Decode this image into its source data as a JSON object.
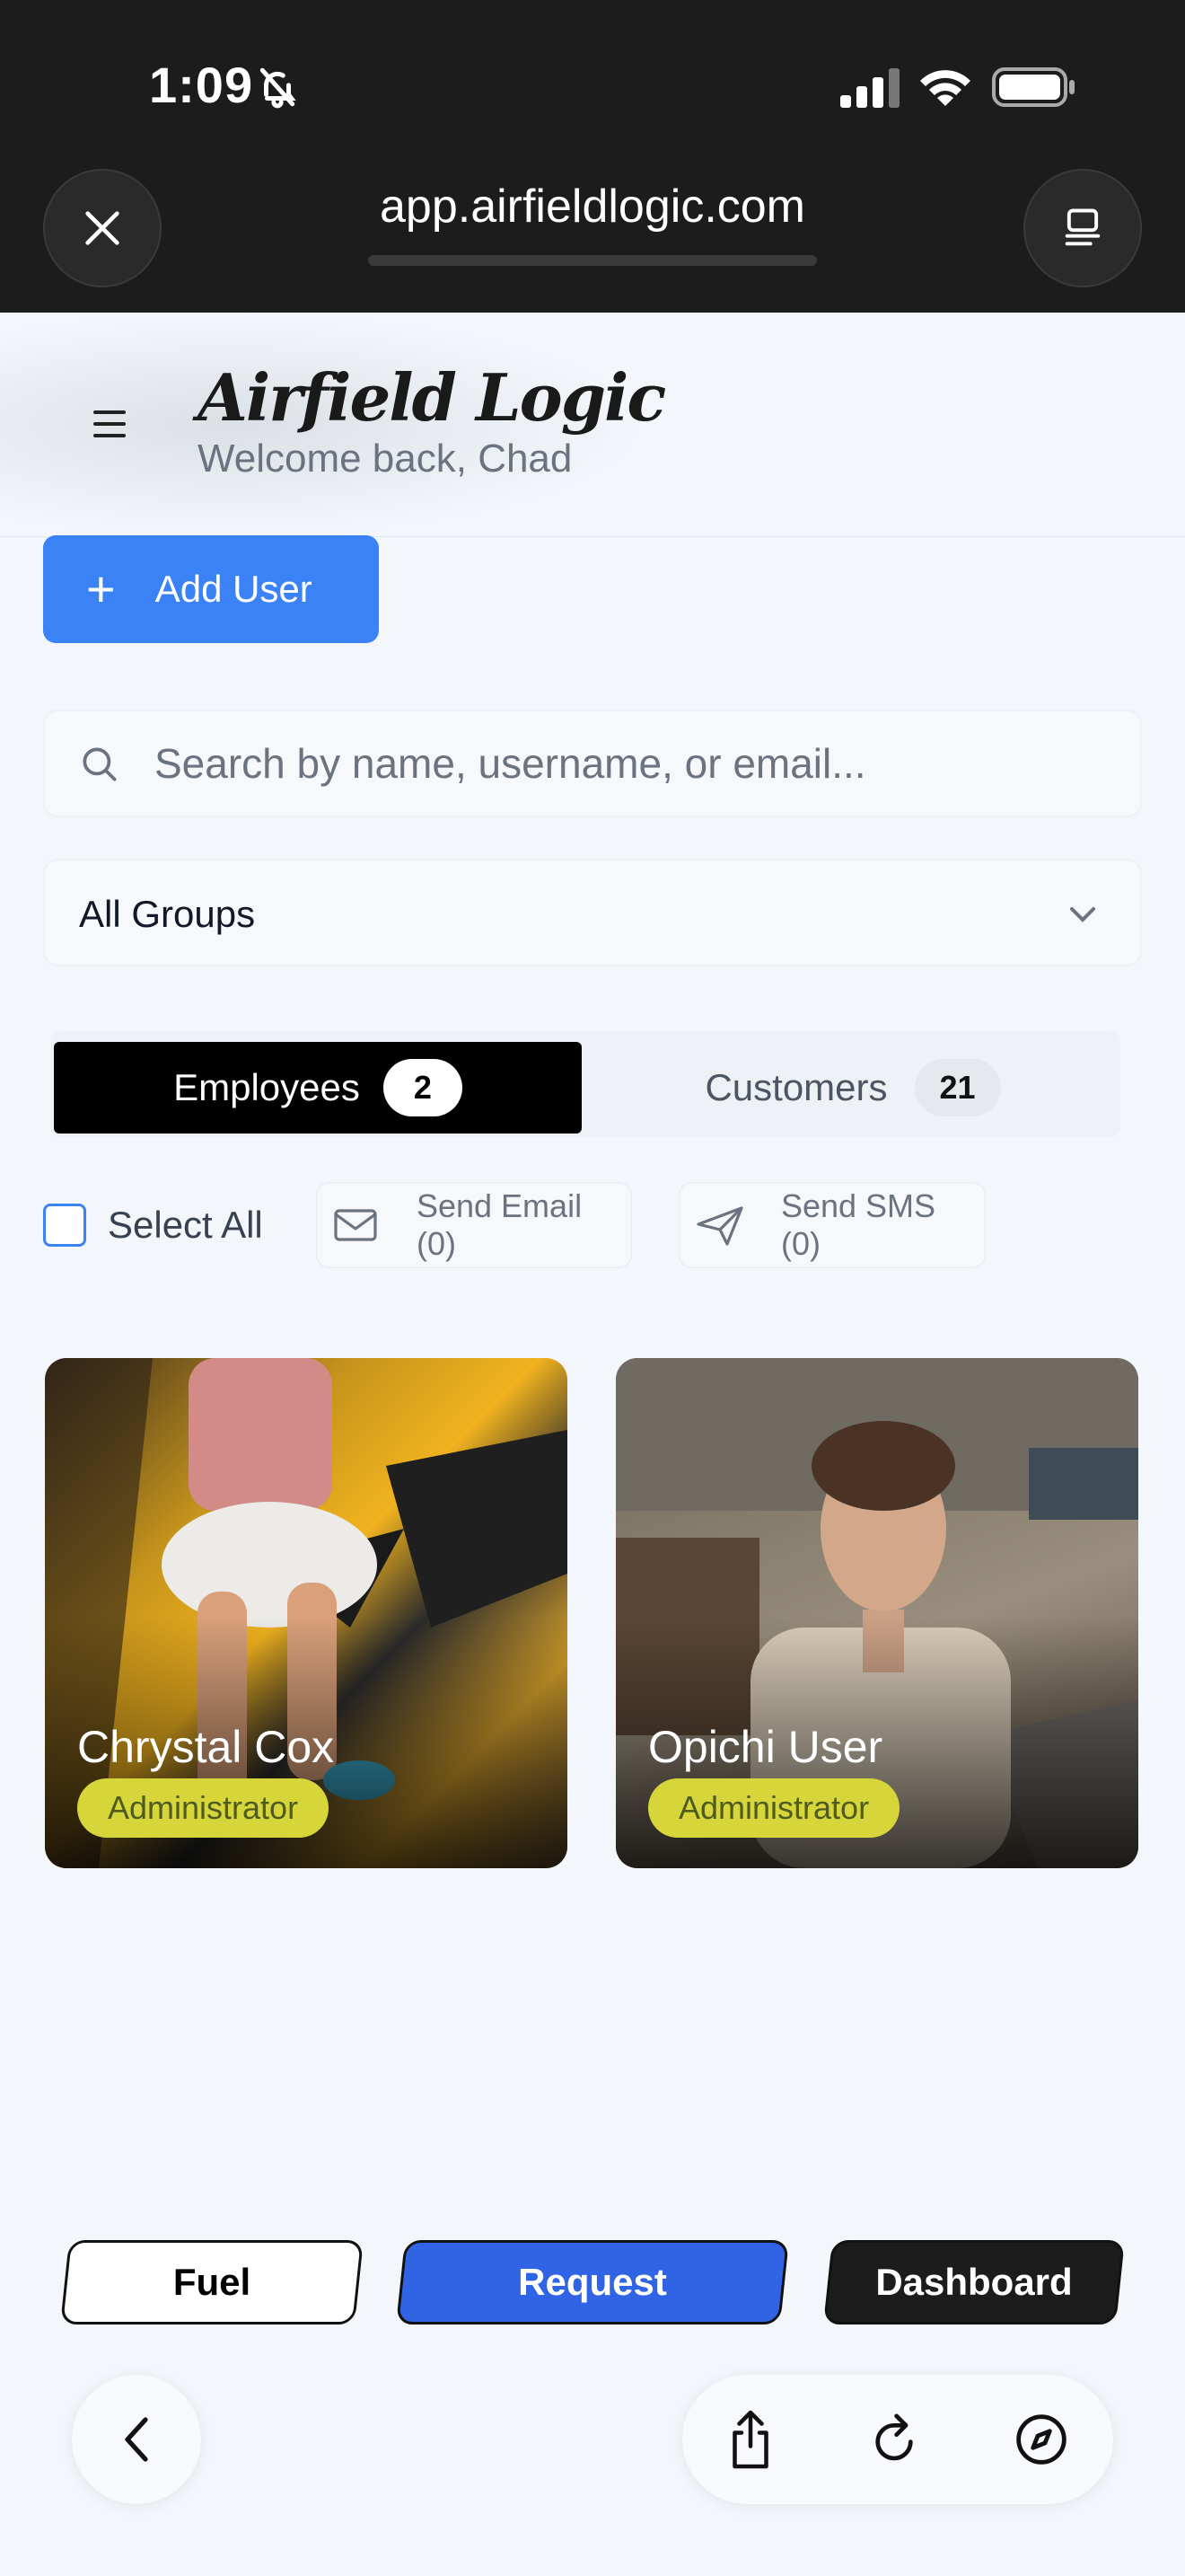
{
  "status_bar": {
    "time": "1:09"
  },
  "browser": {
    "url": "app.airfieldlogic.com"
  },
  "header": {
    "brand": "Airfield Logic",
    "welcome": "Welcome back, Chad"
  },
  "toolbar": {
    "add_user_label": "Add User"
  },
  "search": {
    "placeholder": "Search by name, username, or email..."
  },
  "filter": {
    "group_value": "All Groups"
  },
  "tabs": [
    {
      "label": "Employees",
      "count": "2",
      "active": true
    },
    {
      "label": "Customers",
      "count": "21",
      "active": false
    }
  ],
  "actions": {
    "select_all": "Select All",
    "send_email": "Send Email (0)",
    "send_sms": "Send SMS (0)"
  },
  "users": [
    {
      "name": "Chrystal Cox",
      "role": "Administrator"
    },
    {
      "name": "Opichi User",
      "role": "Administrator"
    }
  ],
  "app_nav": {
    "fuel": "Fuel",
    "request": "Request",
    "dashboard": "Dashboard"
  },
  "colors": {
    "accent": "#3b82f6",
    "request": "#3064e4",
    "badge": "#d6d63a",
    "active_tab": "#000000"
  },
  "icons": [
    "bell-slash-icon",
    "signal-icon",
    "wifi-icon",
    "battery-icon",
    "close-icon",
    "tabs-icon",
    "menu-icon",
    "plus-icon",
    "search-icon",
    "chevron-down-icon",
    "mail-icon",
    "send-icon",
    "back-icon",
    "share-icon",
    "reload-icon",
    "compass-icon"
  ]
}
